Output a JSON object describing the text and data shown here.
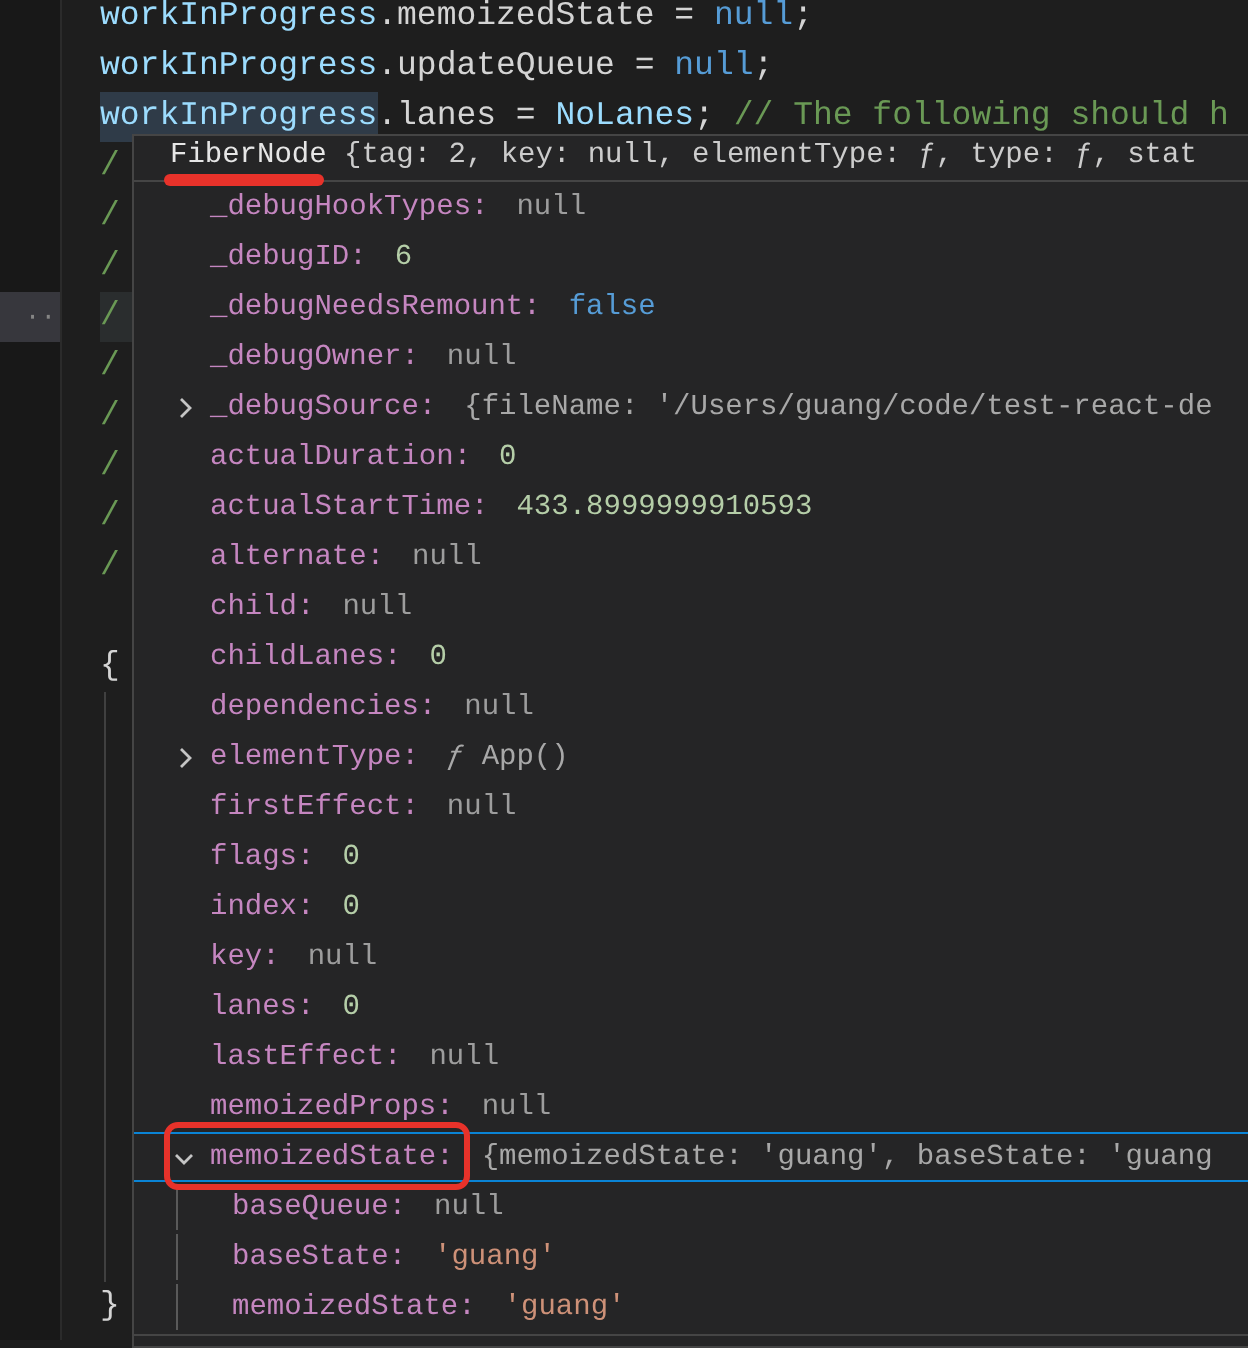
{
  "editor": {
    "lines": [
      {
        "tokens": [
          {
            "text": "workInProgress",
            "kind": "variable"
          },
          {
            "text": ".memoizedState = ",
            "kind": "plain_property"
          },
          {
            "text": "null",
            "kind": "keyword"
          },
          {
            "text": ";",
            "kind": "plain"
          }
        ]
      },
      {
        "tokens": [
          {
            "text": "workInProgress",
            "kind": "variable"
          },
          {
            "text": ".updateQueue = ",
            "kind": "plain_property"
          },
          {
            "text": "null",
            "kind": "keyword"
          },
          {
            "text": ";",
            "kind": "plain"
          }
        ]
      },
      {
        "tokens": [
          {
            "text": "workInProgress",
            "kind": "variable_highlight"
          },
          {
            "text": ".lanes = ",
            "kind": "plain_property"
          },
          {
            "text": "NoLanes",
            "kind": "variable"
          },
          {
            "text": "; ",
            "kind": "plain"
          },
          {
            "text": "// The following should h",
            "kind": "comment"
          }
        ]
      },
      {
        "tokens": [
          {
            "text": "/",
            "kind": "comment"
          }
        ]
      },
      {
        "tokens": [
          {
            "text": "/",
            "kind": "comment"
          }
        ]
      },
      {
        "tokens": [
          {
            "text": "/",
            "kind": "comment"
          }
        ]
      },
      {
        "gutter": "··",
        "tokens": [
          {
            "text": "/",
            "kind": "comment"
          }
        ]
      },
      {
        "tokens": [
          {
            "text": "/",
            "kind": "comment"
          }
        ]
      },
      {
        "tokens": [
          {
            "text": "/",
            "kind": "comment"
          }
        ]
      },
      {
        "tokens": [
          {
            "text": "/",
            "kind": "comment"
          }
        ]
      },
      {
        "tokens": [
          {
            "text": "/",
            "kind": "comment"
          }
        ]
      },
      {
        "tokens": [
          {
            "text": "/",
            "kind": "comment"
          }
        ]
      }
    ],
    "block": {
      "open": "{",
      "close": "}"
    }
  },
  "hover": {
    "header": {
      "class_name": "FiberNode",
      "summary": " {tag: 2, key: null, elementType: ƒ, type: ƒ, stat"
    },
    "rows": [
      {
        "key": "_debugHookTypes:",
        "value": "null",
        "kind": "null",
        "expandable": false,
        "expanded": false,
        "selected": false
      },
      {
        "key": "_debugID:",
        "value": "6",
        "kind": "number",
        "expandable": false,
        "expanded": false,
        "selected": false
      },
      {
        "key": "_debugNeedsRemount:",
        "value": "false",
        "kind": "boolean",
        "expandable": false,
        "expanded": false,
        "selected": false
      },
      {
        "key": "_debugOwner:",
        "value": "null",
        "kind": "null",
        "expandable": false,
        "expanded": false,
        "selected": false
      },
      {
        "key": "_debugSource:",
        "value": "{fileName: '/Users/guang/code/test-react-de",
        "kind": "object",
        "expandable": true,
        "expanded": false,
        "selected": false
      },
      {
        "key": "actualDuration:",
        "value": "0",
        "kind": "number",
        "expandable": false,
        "expanded": false,
        "selected": false
      },
      {
        "key": "actualStartTime:",
        "value": "433.8999999910593",
        "kind": "number",
        "expandable": false,
        "expanded": false,
        "selected": false
      },
      {
        "key": "alternate:",
        "value": "null",
        "kind": "null",
        "expandable": false,
        "expanded": false,
        "selected": false
      },
      {
        "key": "child:",
        "value": "null",
        "kind": "null",
        "expandable": false,
        "expanded": false,
        "selected": false
      },
      {
        "key": "childLanes:",
        "value": "0",
        "kind": "number",
        "expandable": false,
        "expanded": false,
        "selected": false
      },
      {
        "key": "dependencies:",
        "value": "null",
        "kind": "null",
        "expandable": false,
        "expanded": false,
        "selected": false
      },
      {
        "key": "elementType:",
        "value": "*ƒ* App()",
        "kind": "object",
        "expandable": true,
        "expanded": false,
        "selected": false
      },
      {
        "key": "firstEffect:",
        "value": "null",
        "kind": "null",
        "expandable": false,
        "expanded": false,
        "selected": false
      },
      {
        "key": "flags:",
        "value": "0",
        "kind": "number",
        "expandable": false,
        "expanded": false,
        "selected": false
      },
      {
        "key": "index:",
        "value": "0",
        "kind": "number",
        "expandable": false,
        "expanded": false,
        "selected": false
      },
      {
        "key": "key:",
        "value": "null",
        "kind": "null",
        "expandable": false,
        "expanded": false,
        "selected": false
      },
      {
        "key": "lanes:",
        "value": "0",
        "kind": "number",
        "expandable": false,
        "expanded": false,
        "selected": false
      },
      {
        "key": "lastEffect:",
        "value": "null",
        "kind": "null",
        "expandable": false,
        "expanded": false,
        "selected": false
      },
      {
        "key": "memoizedProps:",
        "value": "null",
        "kind": "null",
        "expandable": false,
        "expanded": false,
        "selected": false
      },
      {
        "key": "memoizedState:",
        "value": "{memoizedState: 'guang', baseState: 'guang",
        "kind": "object",
        "expandable": true,
        "expanded": true,
        "selected": true,
        "children": [
          {
            "key": "baseQueue:",
            "value": "null",
            "kind": "null",
            "expandable": false,
            "expanded": false,
            "selected": false
          },
          {
            "key": "baseState:",
            "value": "'guang'",
            "kind": "string",
            "expandable": false,
            "expanded": false,
            "selected": false
          },
          {
            "key": "memoizedState:",
            "value": "'guang'",
            "kind": "string",
            "expandable": false,
            "expanded": false,
            "selected": false
          }
        ]
      }
    ]
  }
}
